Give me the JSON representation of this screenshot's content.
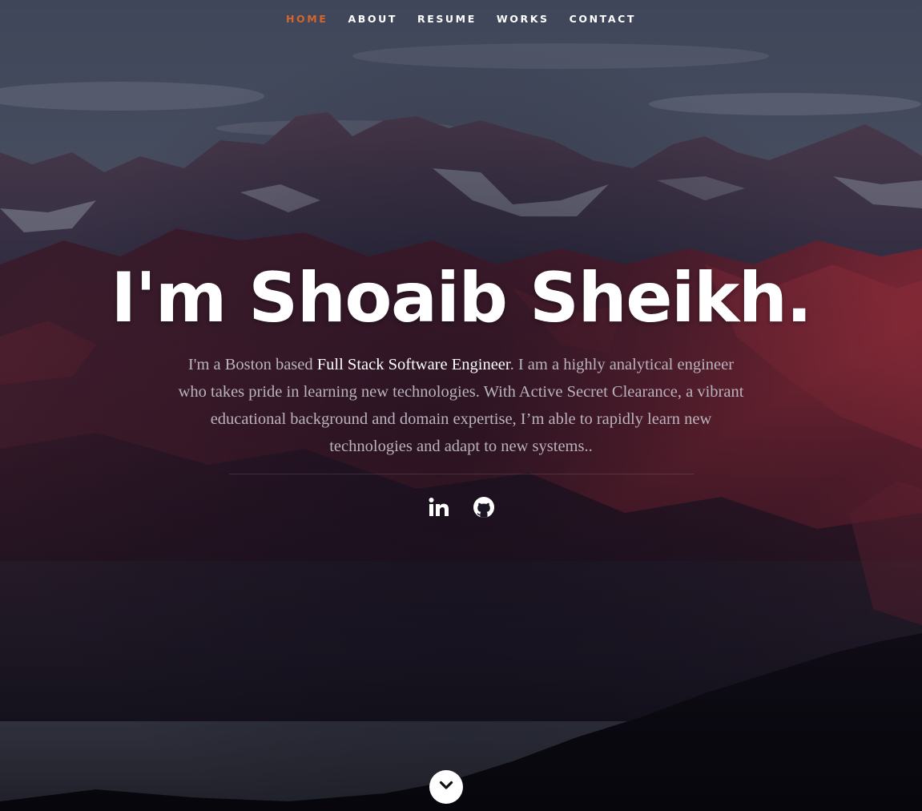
{
  "nav": {
    "items": [
      {
        "label": "HOME",
        "active": true
      },
      {
        "label": "ABOUT",
        "active": false
      },
      {
        "label": "RESUME",
        "active": false
      },
      {
        "label": "WORKS",
        "active": false
      },
      {
        "label": "CONTACT",
        "active": false
      }
    ],
    "active_color": "#d2662b"
  },
  "hero": {
    "title": "I'm Shoaib Sheikh.",
    "intro_before": "I'm a Boston based ",
    "intro_highlight": "Full Stack Software Engineer",
    "intro_after": ". I am a highly analytical engineer who takes pride in learning new technologies. With Active Secret Clearance, a vibrant educational background and domain expertise, I’m able to rapidly learn new technologies and adapt to new systems.."
  },
  "social": {
    "icons": [
      "linkedin-icon",
      "github-icon"
    ]
  },
  "scroll": {
    "icon": "chevron-down-icon"
  }
}
